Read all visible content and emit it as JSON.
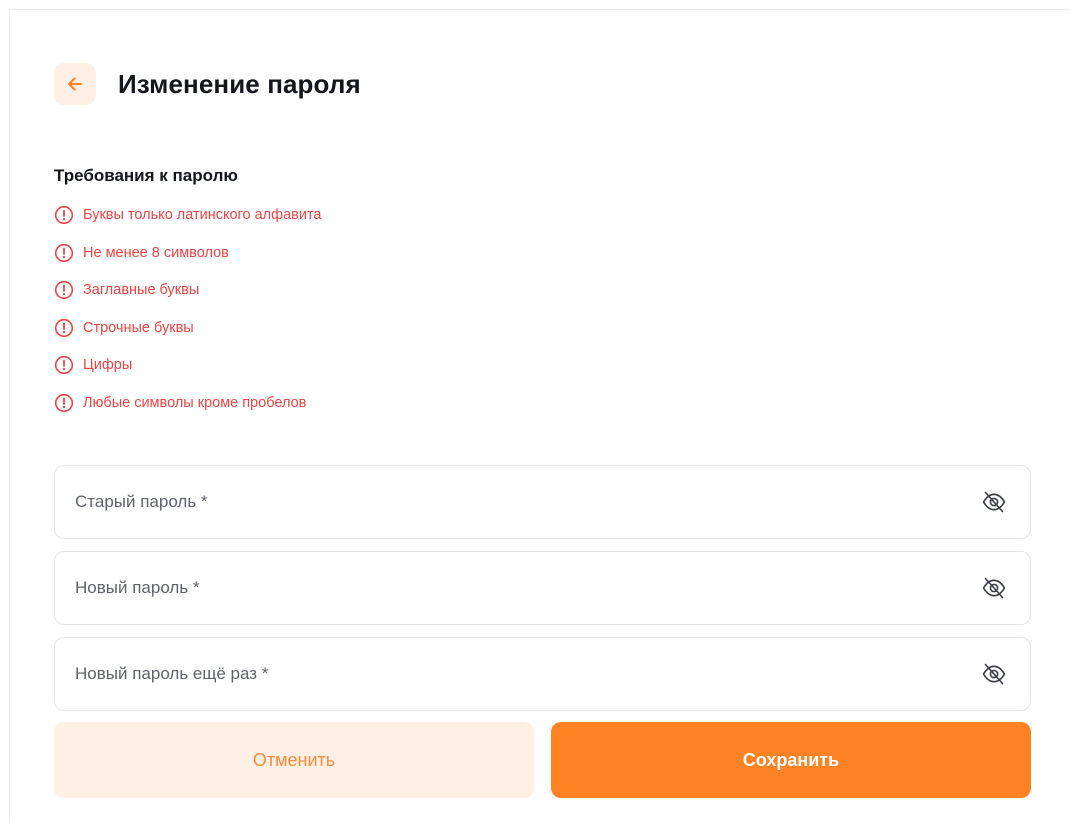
{
  "page": {
    "title": "Изменение пароля"
  },
  "colors": {
    "accent": "#FF8224",
    "accent_soft": "#FFF0E6",
    "error": "#EB4545",
    "text": "#14161C"
  },
  "requirements": {
    "title": "Требования к паролю",
    "items": [
      {
        "label": "Буквы только латинского алфавита",
        "icon": "alert-circle-icon"
      },
      {
        "label": "Не менее 8 символов",
        "icon": "alert-circle-icon"
      },
      {
        "label": "Заглавные буквы",
        "icon": "alert-circle-icon"
      },
      {
        "label": "Строчные буквы",
        "icon": "alert-circle-icon"
      },
      {
        "label": "Цифры",
        "icon": "alert-circle-icon"
      },
      {
        "label": "Любые символы кроме пробелов",
        "icon": "alert-circle-icon"
      }
    ]
  },
  "form": {
    "old_password": {
      "placeholder": "Старый пароль *",
      "value": ""
    },
    "new_password": {
      "placeholder": "Новый пароль *",
      "value": ""
    },
    "repeat_password": {
      "placeholder": "Новый пароль ещё раз *",
      "value": ""
    }
  },
  "actions": {
    "cancel_label": "Отменить",
    "save_label": "Сохранить"
  }
}
